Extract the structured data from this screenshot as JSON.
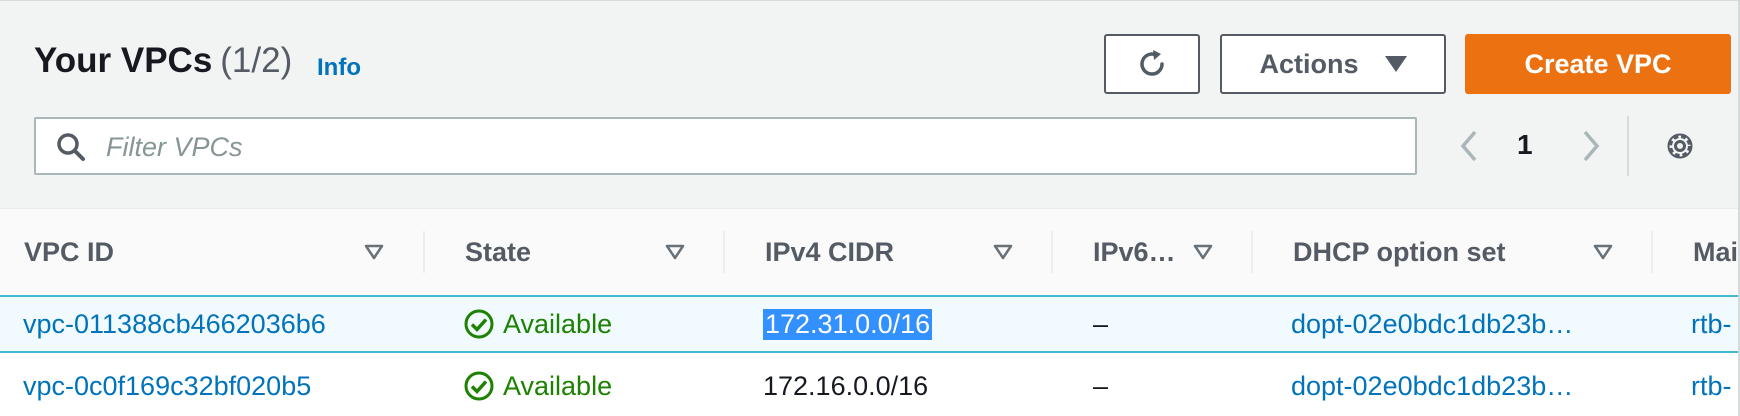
{
  "header": {
    "title": "Your VPCs",
    "count": "(1/2)",
    "info": "Info",
    "actions_label": "Actions",
    "create_label": "Create VPC",
    "search_placeholder": "Filter VPCs",
    "page": "1",
    "accent_color": "#ec7211",
    "link_color": "#0073bb"
  },
  "icons": {
    "refresh": "refresh-icon",
    "caret": "caret-down-icon",
    "search": "search-icon",
    "prev": "chevron-left-icon",
    "next": "chevron-right-icon",
    "settings": "gear-icon",
    "sort": "sort-triangle-icon",
    "status": "check-circle-icon"
  },
  "table": {
    "columns": [
      "VPC ID",
      "State",
      "IPv4 CIDR",
      "IPv6…",
      "DHCP option set",
      "Mai"
    ],
    "rows": [
      {
        "vpc_id": "vpc-011388cb4662036b6",
        "state": "Available",
        "ipv4": "172.31.0.0/16",
        "ipv6": "–",
        "dhcp": "dopt-02e0bdc1db23b…",
        "main": "rtb-",
        "selected": true
      },
      {
        "vpc_id": "vpc-0c0f169c32bf020b5",
        "state": "Available",
        "ipv4": "172.16.0.0/16",
        "ipv6": "–",
        "dhcp": "dopt-02e0bdc1db23b…",
        "main": "rtb-",
        "selected": false
      }
    ]
  }
}
